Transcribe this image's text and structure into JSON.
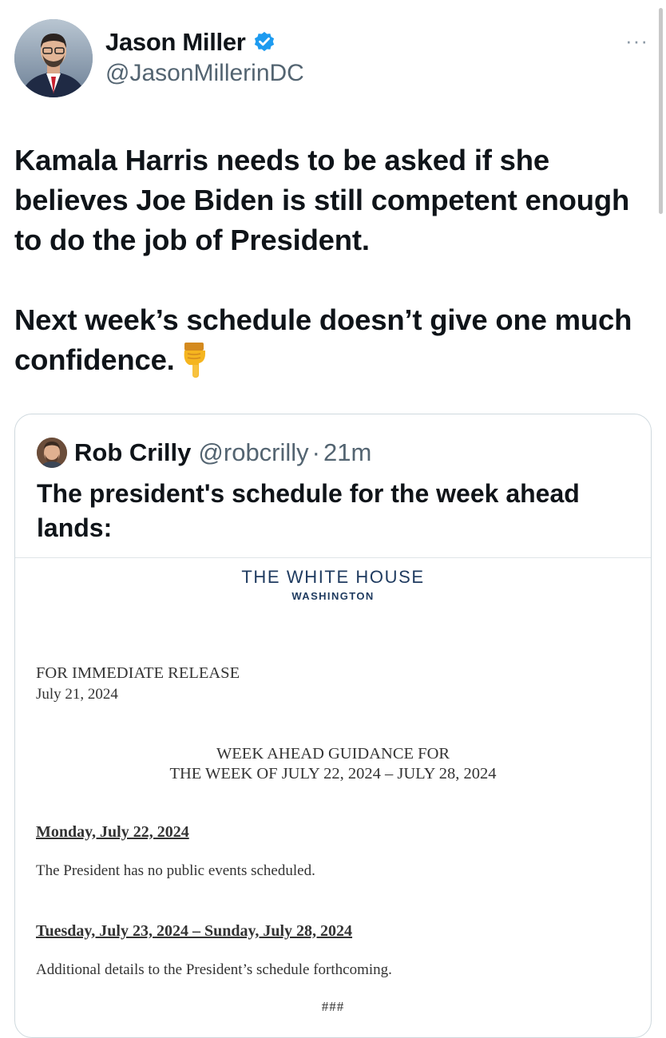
{
  "author": {
    "display_name": "Jason Miller",
    "handle": "@JasonMillerinDC"
  },
  "more_label": "···",
  "tweet": {
    "paragraph_1": "Kamala Harris needs to be asked if she believes Joe Biden is still competent enough to do the job of President.",
    "paragraph_2": "Next week’s schedule doesn’t give one much confidence."
  },
  "quoted": {
    "display_name": "Rob Crilly",
    "handle": "@robcrilly",
    "separator": "·",
    "time": "21m",
    "text": "The president's schedule for the week ahead lands:",
    "document": {
      "header_title": "THE WHITE HOUSE",
      "header_subtitle": "WASHINGTON",
      "release_label": "FOR IMMEDIATE RELEASE",
      "release_date": "July 21, 2024",
      "guidance_line_1": "WEEK AHEAD GUIDANCE FOR",
      "guidance_line_2": "THE WEEK OF JULY 22, 2024 – JULY 28, 2024",
      "day_1_heading": "Monday, July 22, 2024",
      "day_1_text": "The President has no public events scheduled.",
      "day_2_heading": "Tuesday, July 23, 2024 – Sunday, July 28, 2024",
      "day_2_text": "Additional details to the President’s schedule forthcoming.",
      "end_mark": "###"
    }
  },
  "colors": {
    "text_primary": "#0f1419",
    "text_secondary": "#536471",
    "verified_blue": "#1d9bf0",
    "white_house_navy": "#1e3a5f",
    "border": "#cfd9de"
  }
}
